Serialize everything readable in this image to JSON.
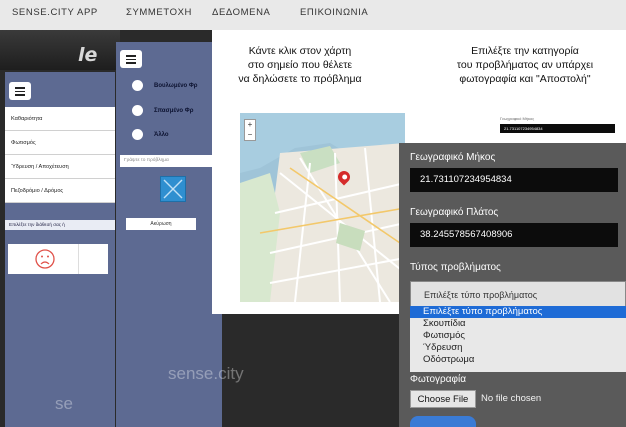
{
  "nav": {
    "items": [
      "SENSE.CITY APP",
      "ΣΥΜΜΕΤΟΧΗ",
      "ΔΕΔΟΜΕΝΑ",
      "ΕΠΙΚΟΙΝΩΝΙΑ"
    ]
  },
  "logo_partial": "le",
  "phone1": {
    "categories": [
      "Καθαριότητα",
      "Φωτισμός",
      "Ύδρευση / Αποχέτευση",
      "Πεζοδρόμιο / Δρόμος"
    ],
    "hint": "Επιλέξτε την διάθεσή σας ή",
    "watermark": "se"
  },
  "phone2": {
    "options": [
      "Βουλωμένο Φρ",
      "Σπασμένο Φρ",
      "Άλλο"
    ],
    "description_placeholder": "Γράψτε το πρόβλημα",
    "cancel_label": "Ακύρωση",
    "watermark": "sense.city"
  },
  "instructions": {
    "left": [
      "Κάντε κλικ στον χάρτη",
      "στο σημείο που θέλετε",
      "να δηλώσετε το πρόβλημα"
    ],
    "right": [
      "Επιλέξτε την κατηγορία",
      "του προβλήματος αν υπάρχει",
      "φωτογραφία και \"Αποστολή\""
    ]
  },
  "mini": {
    "label": "Γεωγραφικό Μήκος",
    "value": "21.731107234954834"
  },
  "form": {
    "longitude_label": "Γεωγραφικό Μήκος",
    "longitude_value": "21.731107234954834",
    "latitude_label": "Γεωγραφικό Πλάτος",
    "latitude_value": "38.245578567408906",
    "type_label": "Τύπος προβλήματος",
    "type_selected": "Επιλέξτε τύπο προβλήματος",
    "type_options": [
      "Επιλέξτε τύπο προβλήματος",
      "Σκουπίδια",
      "Φωτισμός",
      "Ύδρευση",
      "Οδόστρωμα"
    ],
    "photo_label": "Φωτογραφία",
    "choose_file_label": "Choose File",
    "no_file_label": "No file chosen"
  },
  "colors": {
    "phone_bg": "#5d6a92",
    "accent_blue": "#1e6bd6",
    "pin": "#d52b2b"
  }
}
